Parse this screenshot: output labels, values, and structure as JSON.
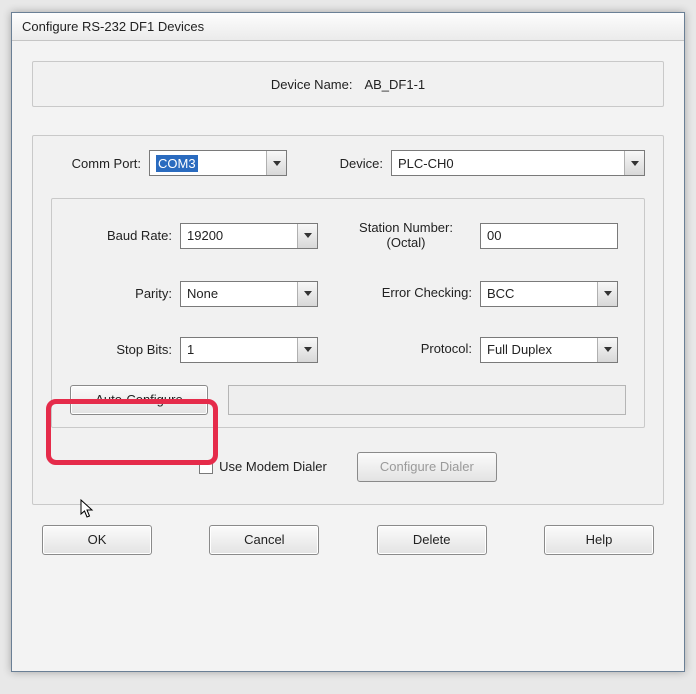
{
  "window": {
    "title": "Configure RS-232 DF1 Devices"
  },
  "header": {
    "device_name_label": "Device Name:",
    "device_name_value": "AB_DF1-1"
  },
  "top": {
    "comm_port_label": "Comm Port:",
    "comm_port_value": "COM3",
    "device_label": "Device:",
    "device_value": "PLC-CH0"
  },
  "settings": {
    "baud_rate_label": "Baud Rate:",
    "baud_rate_value": "19200",
    "station_number_label_line1": "Station Number:",
    "station_number_label_line2": "(Octal)",
    "station_number_value": "00",
    "parity_label": "Parity:",
    "parity_value": "None",
    "error_checking_label": "Error Checking:",
    "error_checking_value": "BCC",
    "stop_bits_label": "Stop Bits:",
    "stop_bits_value": "1",
    "protocol_label": "Protocol:",
    "protocol_value": "Full Duplex",
    "auto_configure_button": "Auto-Configure",
    "use_modem_dialer_label": "Use Modem Dialer",
    "use_modem_dialer_checked": false,
    "configure_dialer_button": "Configure Dialer"
  },
  "buttons": {
    "ok": "OK",
    "cancel": "Cancel",
    "delete": "Delete",
    "help": "Help"
  }
}
